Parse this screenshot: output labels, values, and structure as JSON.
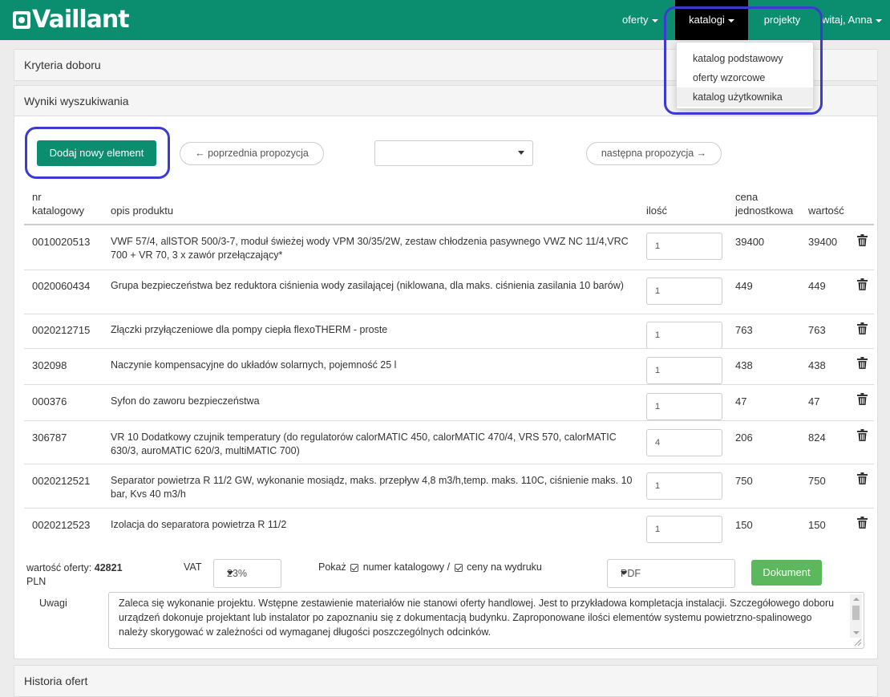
{
  "nav": {
    "brand": "Vaillant",
    "oferty": "oferty",
    "katalogi": "katalogi",
    "projekty": "projekty",
    "witaj": "witaj, Anna",
    "katalogi_menu": [
      "katalog podstawowy",
      "oferty wzorcowe",
      "katalog użytkownika"
    ]
  },
  "panels": {
    "kryteria": "Kryteria doboru",
    "wyniki": "Wyniki wyszukiwania",
    "historia": "Historia ofert"
  },
  "toolbar": {
    "add": "Dodaj nowy element",
    "prev": "← poprzednia propozycja",
    "next": "następna propozycja →",
    "proposal_value": ""
  },
  "table": {
    "headers": {
      "code_1": "nr",
      "code_2": "katalogowy",
      "desc": "opis produktu",
      "qty": "ilość",
      "price_1": "cena",
      "price_2": "jednostkowa",
      "value": "wartość"
    },
    "rows": [
      {
        "code": "0010020513",
        "desc": "VWF 57/4, allSTOR 500/3-7, moduł świeżej wody VPM 30/35/2W, zestaw chłodzenia pasywnego VWZ NC 11/4,VRC 700 + VR 70, 3 x zawór przełączający*",
        "qty": "1",
        "price": "39400",
        "value": "39400"
      },
      {
        "code": "0020060434",
        "desc": "Grupa bezpieczeństwa bez reduktora ciśnienia wody zasilającej (niklowana, dla maks. ciśnienia zasilania 10 barów)",
        "qty": "1",
        "price": "449",
        "value": "449"
      },
      {
        "code": "0020212715",
        "desc": "Złączki przyłączeniowe dla pompy ciepła flexoTHERM - proste",
        "qty": "1",
        "price": "763",
        "value": "763"
      },
      {
        "code": "302098",
        "desc": "Naczynie kompensacyjne do układów solarnych, pojemność 25 l",
        "qty": "1",
        "price": "438",
        "value": "438"
      },
      {
        "code": "000376",
        "desc": "Syfon do zaworu bezpieczeństwa",
        "qty": "1",
        "price": "47",
        "value": "47"
      },
      {
        "code": "306787",
        "desc": "VR 10 Dodatkowy czujnik temperatury (do regulatorów calorMATIC 450, calorMATIC 470/4, VRS 570, calorMATIC 630/3, auroMATIC 620/3, multiMATIC 700)",
        "qty": "4",
        "price": "206",
        "value": "824"
      },
      {
        "code": "0020212521",
        "desc": "Separator powietrza R 11/2 GW, wykonanie mosiądz, maks. przepływ 4,8 m3/h,temp. maks. 110C, ciśnienie maks. 10 bar, Kvs 40 m3/h",
        "qty": "1",
        "price": "750",
        "value": "750"
      },
      {
        "code": "0020212523",
        "desc": "Izolacja do separatora powietrza R 11/2",
        "qty": "1",
        "price": "150",
        "value": "150"
      }
    ]
  },
  "summary": {
    "total_label": "wartość oferty:",
    "total_value": "42821",
    "currency": "PLN",
    "vat_label": "VAT",
    "vat_value": "23%",
    "show_label": "Pokaż",
    "show_catalog": "numer katalogowy /",
    "show_prices": "ceny na wydruku",
    "format_value": "PDF",
    "document_button": "Dokument",
    "notes_label": "Uwagi",
    "notes_text": "Zaleca się wykonanie projektu. Wstępne zestawienie materiałów nie stanowi oferty handlowej. Jest to przykładowa kompletacja instalacji. Szczegółowego doboru urządzeń dokonuje projektant lub instalator po zapoznaniu się z dokumentacją budynku. Zaproponowane ilości elementów systemu powietrzno-spalinowego należy skorygować w zależności od wymaganej długości poszczególnych odcinków."
  },
  "colors": {
    "brand_green": "#0b8d70",
    "document_green": "#5cb85c",
    "annotation_blue": "#3b3bd2"
  }
}
